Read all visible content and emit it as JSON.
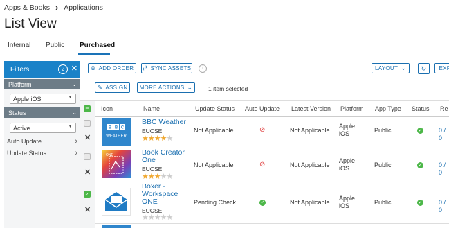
{
  "breadcrumb": {
    "parent": "Apps & Books",
    "current": "Applications"
  },
  "page_title": "List View",
  "tabs": [
    {
      "label": "Internal"
    },
    {
      "label": "Public"
    },
    {
      "label": "Purchased",
      "active": true
    }
  ],
  "filters": {
    "title": "Filters",
    "count": "2",
    "sections": {
      "platform": {
        "label": "Platform",
        "value": "Apple iOS"
      },
      "status": {
        "label": "Status",
        "value": "Active"
      }
    },
    "items": [
      "Auto Update",
      "Update Status"
    ]
  },
  "toolbar": {
    "add_order": "ADD ORDER",
    "sync_assets": "SYNC ASSETS",
    "layout": "LAYOUT",
    "export": "EXP",
    "assign": "ASSIGN",
    "more_actions": "MORE ACTIONS",
    "selected_text": "1 item selected"
  },
  "columns": [
    "Icon",
    "Name",
    "Update Status",
    "Auto Update",
    "Latest Version",
    "Platform",
    "App Type",
    "Status",
    "Re"
  ],
  "rows": [
    {
      "name": "BBC Weather",
      "publisher": "EUCSE",
      "update_status": "Not Applicable",
      "latest_version": "Not Applicable",
      "platform": "Apple iOS",
      "app_type": "Public",
      "rating": 4,
      "auto_update": "no",
      "selected": false,
      "link": "0 / 0"
    },
    {
      "name": "Book Creator One",
      "publisher": "EUCSE",
      "update_status": "Not Applicable",
      "latest_version": "Not Applicable",
      "platform": "Apple iOS",
      "app_type": "Public",
      "rating": 3,
      "auto_update": "no",
      "selected": false,
      "link": "0 / 0"
    },
    {
      "name": "Boxer - Workspace ONE",
      "publisher": "EUCSE",
      "update_status": "Pending Check",
      "latest_version": "Not Applicable",
      "platform": "Apple iOS",
      "app_type": "Public",
      "rating": 0,
      "auto_update": "yes",
      "selected": true,
      "link": "0 / 0"
    }
  ],
  "icons": {
    "bbc": "bbc-weather-logo",
    "book": "book-creator-logo",
    "boxer": "boxer-envelope-logo"
  },
  "colors": {
    "accent": "#1a82c8",
    "success": "#4cb748",
    "danger": "#e04040",
    "star": "#f0a830"
  }
}
